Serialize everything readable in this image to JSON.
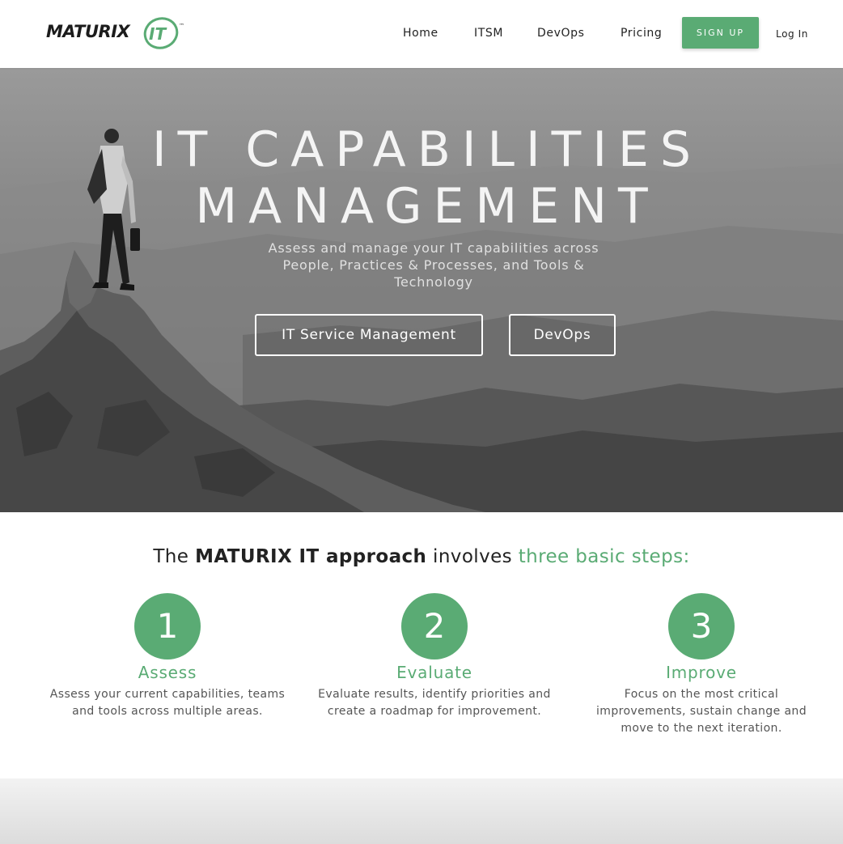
{
  "header": {
    "logo": {
      "text": "MATURIX",
      "it": "IT",
      "tm": "™"
    },
    "nav": [
      "Home",
      "ITSM",
      "DevOps",
      "Pricing"
    ],
    "signup_label": "SIGN UP",
    "login_label": "Log In"
  },
  "hero": {
    "title_line1": "IT CAPABILITIES",
    "title_line2": "MANAGEMENT",
    "subtitle": "Assess and manage your IT capabilities across People, Practices & Processes, and Tools & Technology",
    "buttons": [
      "IT Service Management",
      "DevOps"
    ]
  },
  "steps": {
    "heading_pre": "The ",
    "heading_bold": "MATURIX IT approach",
    "heading_mid": " involves ",
    "heading_green": "three basic steps:",
    "items": [
      {
        "number": "1",
        "title": "Assess",
        "desc": "Assess your current capabilities, teams and tools across multiple areas."
      },
      {
        "number": "2",
        "title": "Evaluate",
        "desc": "Evaluate results, identify priorities and create a roadmap for improvement."
      },
      {
        "number": "3",
        "title": "Improve",
        "desc": "Focus on the most critical improvements, sustain change and move to the next iteration."
      }
    ]
  },
  "colors": {
    "brand_green": "#5aab74"
  }
}
